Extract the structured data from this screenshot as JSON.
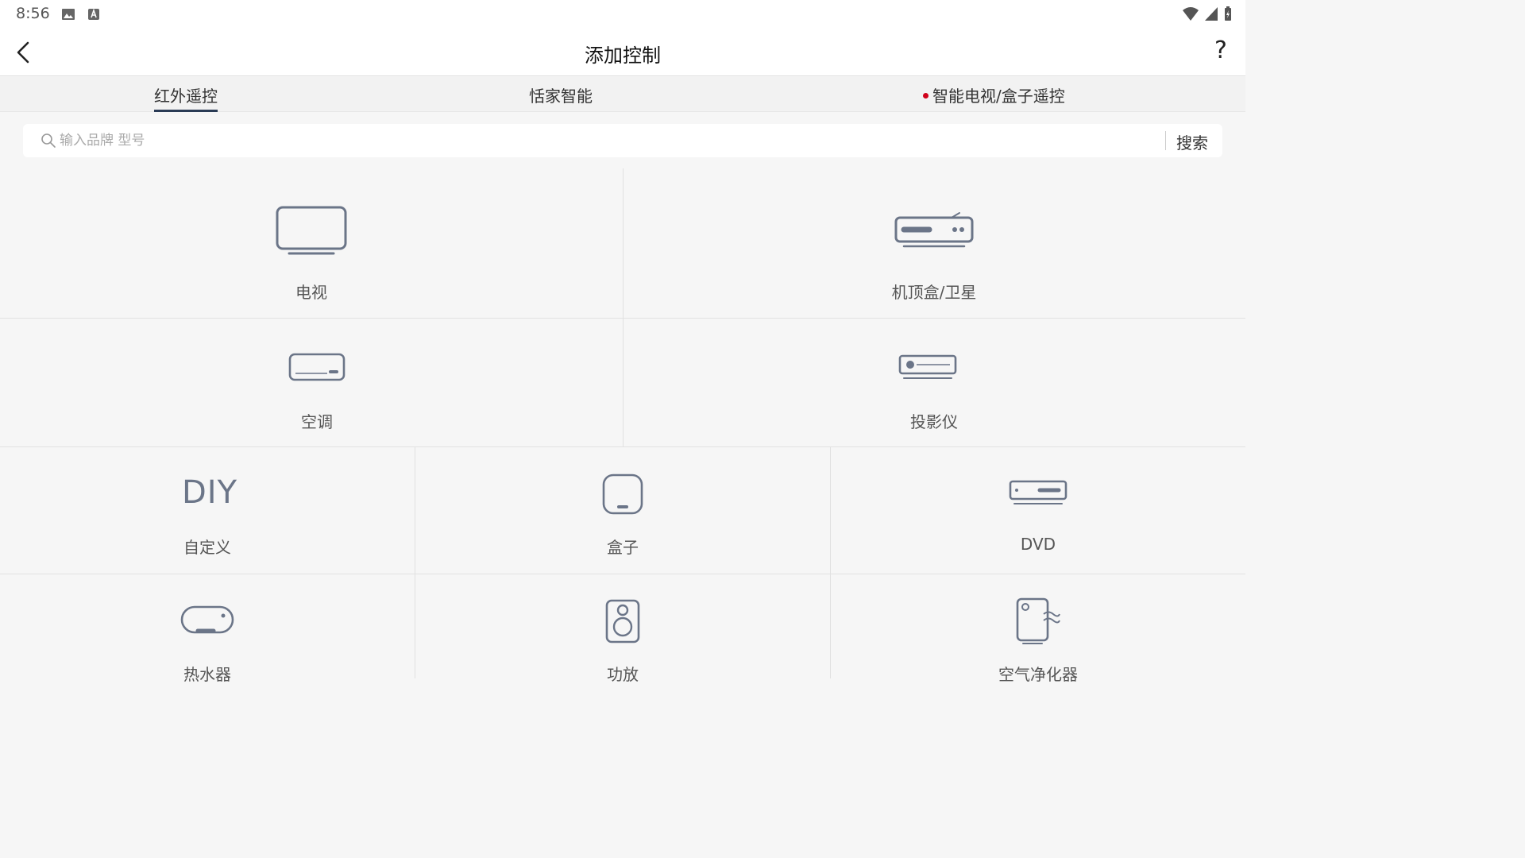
{
  "status": {
    "time": "8:56"
  },
  "header": {
    "title": "添加控制",
    "help": "?"
  },
  "tabs": [
    {
      "label": "红外遥控"
    },
    {
      "label": "恬家智能"
    },
    {
      "label": "智能电视/盒子遥控"
    }
  ],
  "search": {
    "placeholder": "输入品牌 型号",
    "button": "搜索"
  },
  "devices": {
    "tv": "电视",
    "stb": "机顶盒/卫星",
    "ac": "空调",
    "projector": "投影仪",
    "diy_icon": "DIY",
    "diy": "自定义",
    "box": "盒子",
    "dvd": "DVD",
    "water_heater": "热水器",
    "amplifier": "功放",
    "air_purifier": "空气净化器"
  }
}
